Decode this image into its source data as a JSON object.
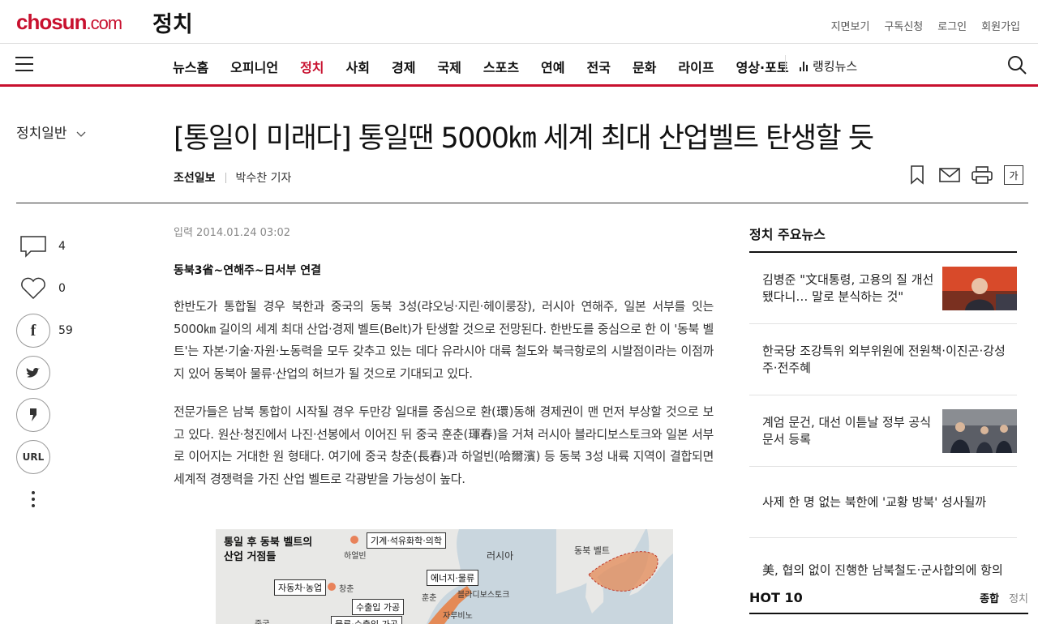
{
  "header": {
    "logo": "chosun",
    "logo_suffix": ".com",
    "section": "정치",
    "util_links": [
      "지면보기",
      "구독신청",
      "로그인",
      "회원가입"
    ]
  },
  "nav": {
    "items": [
      "뉴스홈",
      "오피니언",
      "정치",
      "사회",
      "경제",
      "국제",
      "스포츠",
      "연예",
      "전국",
      "문화",
      "라이프",
      "영상·포토"
    ],
    "active": "정치",
    "ranking": "랭킹뉴스"
  },
  "article_header": {
    "category": "정치일반",
    "title": "[통일이 미래다] 통일땐 5000㎞ 세계 최대 산업벨트 탄생할 듯",
    "paper": "조선일보",
    "reporter": "박수찬 기자",
    "font_button": "가"
  },
  "share": {
    "comments": "4",
    "likes": "0",
    "facebook": "59",
    "url_label": "URL"
  },
  "article": {
    "date": "입력 2014.01.24 03:02",
    "subhead": "동북3省~연해주~日서부 연결",
    "paragraphs": [
      "한반도가 통합될 경우 북한과 중국의 동북 3성(랴오닝·지린·헤이룽장), 러시아 연해주, 일본 서부를 잇는 5000㎞ 길이의 세계 최대 산업·경제 벨트(Belt)가 탄생할 것으로 전망된다. 한반도를 중심으로 한 이 '동북 벨트'는 자본·기술·자원·노동력을 모두 갖추고 있는 데다 유라시아 대륙 철도와 북극항로의 시발점이라는 이점까지 있어 동북아 물류·산업의 허브가 될 것으로 기대되고 있다.",
      "전문가들은 남북 통합이 시작될 경우 두만강 일대를 중심으로 환(環)동해 경제권이 맨 먼저 부상할 것으로 보고 있다. 원산·청진에서 나진·선봉에서 이어진 뒤 중국 훈춘(琿春)을 거쳐 러시아 블라디보스토크와 일본 서부로 이어지는 거대한 원 형태다. 여기에 중국 창춘(長春)과 하얼빈(哈爾濱) 등 동북 3성 내륙 지역이 결합되면 세계적 경쟁력을 가진 산업 벨트로 각광받을 가능성이 높다."
    ]
  },
  "figure": {
    "title_line1": "통일 후 동북 벨트의",
    "title_line2": "산업 거점들",
    "tags": [
      "기계·석유화학·의학",
      "자동차·농업",
      "에너지·물류",
      "수출입 가공",
      "물류·수출입 가공"
    ],
    "places": [
      "하얼빈",
      "창춘",
      "러시아",
      "블라디보스토크",
      "훈춘",
      "자루비노",
      "중국"
    ],
    "inset_label": "동북 벨트"
  },
  "sidebar": {
    "heading": "정치 주요뉴스",
    "news": [
      {
        "text": "김병준 \"文대통령, 고용의 질 개선됐다니… 말로 분식하는 것\"",
        "thumb": true
      },
      {
        "text": "한국당 조강특위 외부위원에 전원책·이진곤·강성주·전주혜",
        "thumb": false
      },
      {
        "text": "계엄 문건, 대선 이튿날 정부 공식 문서 등록",
        "thumb": true
      },
      {
        "text": "사제 한 명 없는 북한에 '교황 방북' 성사될까",
        "thumb": false
      },
      {
        "text": "美, 협의 없이 진행한 남북철도·군사합의에 항의",
        "thumb": false
      }
    ],
    "hot_heading": "HOT 10",
    "hot_tabs": [
      "종합",
      "정치"
    ]
  }
}
